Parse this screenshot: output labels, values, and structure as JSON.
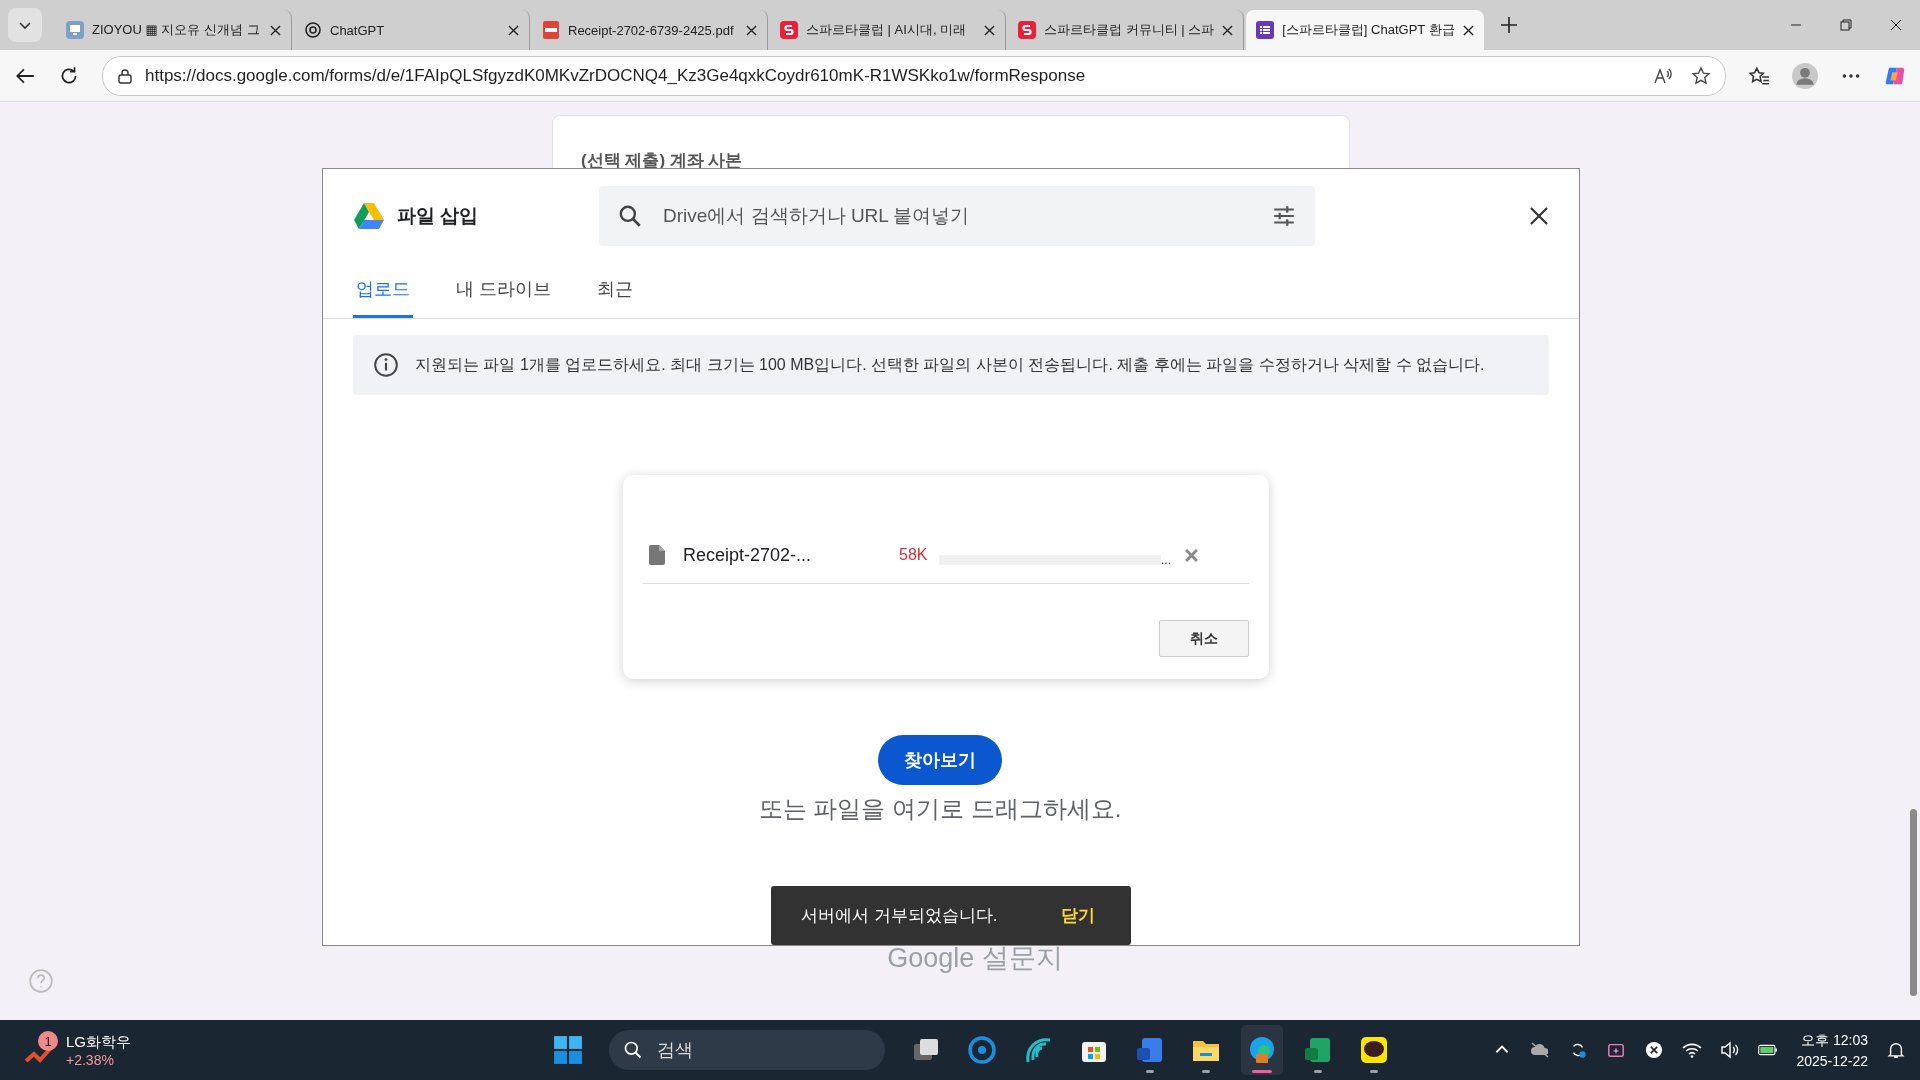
{
  "browser": {
    "tabs": [
      {
        "title": "ZIOYOU ▦ 지오유 신개념 그",
        "kind": "monitor",
        "selected": false
      },
      {
        "title": "ChatGPT",
        "kind": "chatgpt",
        "selected": false
      },
      {
        "title": "Receipt-2702-6739-2425.pdf",
        "kind": "pdf",
        "selected": false
      },
      {
        "title": "스파르타클럽 | AI시대, 미래",
        "kind": "sparta",
        "selected": false
      },
      {
        "title": "스파르타클럽 커뮤니티 | 스파",
        "kind": "sparta",
        "selected": false
      },
      {
        "title": "[스파르타클럽] ChatGPT 환급",
        "kind": "forms",
        "selected": true
      }
    ],
    "url": "https://docs.google.com/forms/d/e/1FAIpQLSfgyzdK0MKvZrDOCNQ4_Kz3Ge4qxkCoydr610mK-R1WSKko1w/formResponse"
  },
  "form": {
    "section_title": "(선택 제출) 계좌 사본",
    "footer": {
      "brand": "Google",
      "product": "설문지"
    }
  },
  "dialog": {
    "title": "파일 삽입",
    "search": {
      "placeholder": "Drive에서 검색하거나 URL 붙여넣기"
    },
    "tabs": [
      {
        "label": "업로드",
        "selected": true
      },
      {
        "label": "내 드라이브",
        "selected": false
      },
      {
        "label": "최근",
        "selected": false
      }
    ],
    "notice": "지원되는 파일 1개를 업로드하세요. 최대 크기는 100 MB입니다. 선택한 파일의 사본이 전송됩니다. 제출 후에는 파일을 수정하거나 삭제할 수 없습니다.",
    "upload": {
      "file_name": "Receipt-2702-...",
      "size": "58K",
      "level": 0,
      "status": "...",
      "cancel": "취소"
    },
    "browse": "찾아보기",
    "drop_hint": "또는 파일을 여기로 드래그하세요."
  },
  "snackbar": {
    "message": "서버에서 거부되었습니다.",
    "action": "닫기"
  },
  "taskbar": {
    "stock": {
      "badge": "1",
      "name": "LG화학우",
      "change": "+2.38%"
    },
    "search": {
      "placeholder": "검색"
    },
    "apps": [
      {
        "kind": "taskview",
        "running": false,
        "selected": false
      },
      {
        "kind": "cortana",
        "running": false,
        "selected": false
      },
      {
        "kind": "wave",
        "running": false,
        "selected": false
      },
      {
        "kind": "store",
        "running": false,
        "selected": false
      },
      {
        "kind": "word",
        "running": true,
        "selected": false
      },
      {
        "kind": "folder",
        "running": true,
        "selected": false
      },
      {
        "kind": "edge",
        "running": true,
        "selected": true
      },
      {
        "kind": "excel",
        "running": true,
        "selected": false
      },
      {
        "kind": "talk",
        "running": true,
        "selected": false
      }
    ],
    "clock": {
      "time": "오후 12:03",
      "date": "2025-12-22"
    }
  }
}
